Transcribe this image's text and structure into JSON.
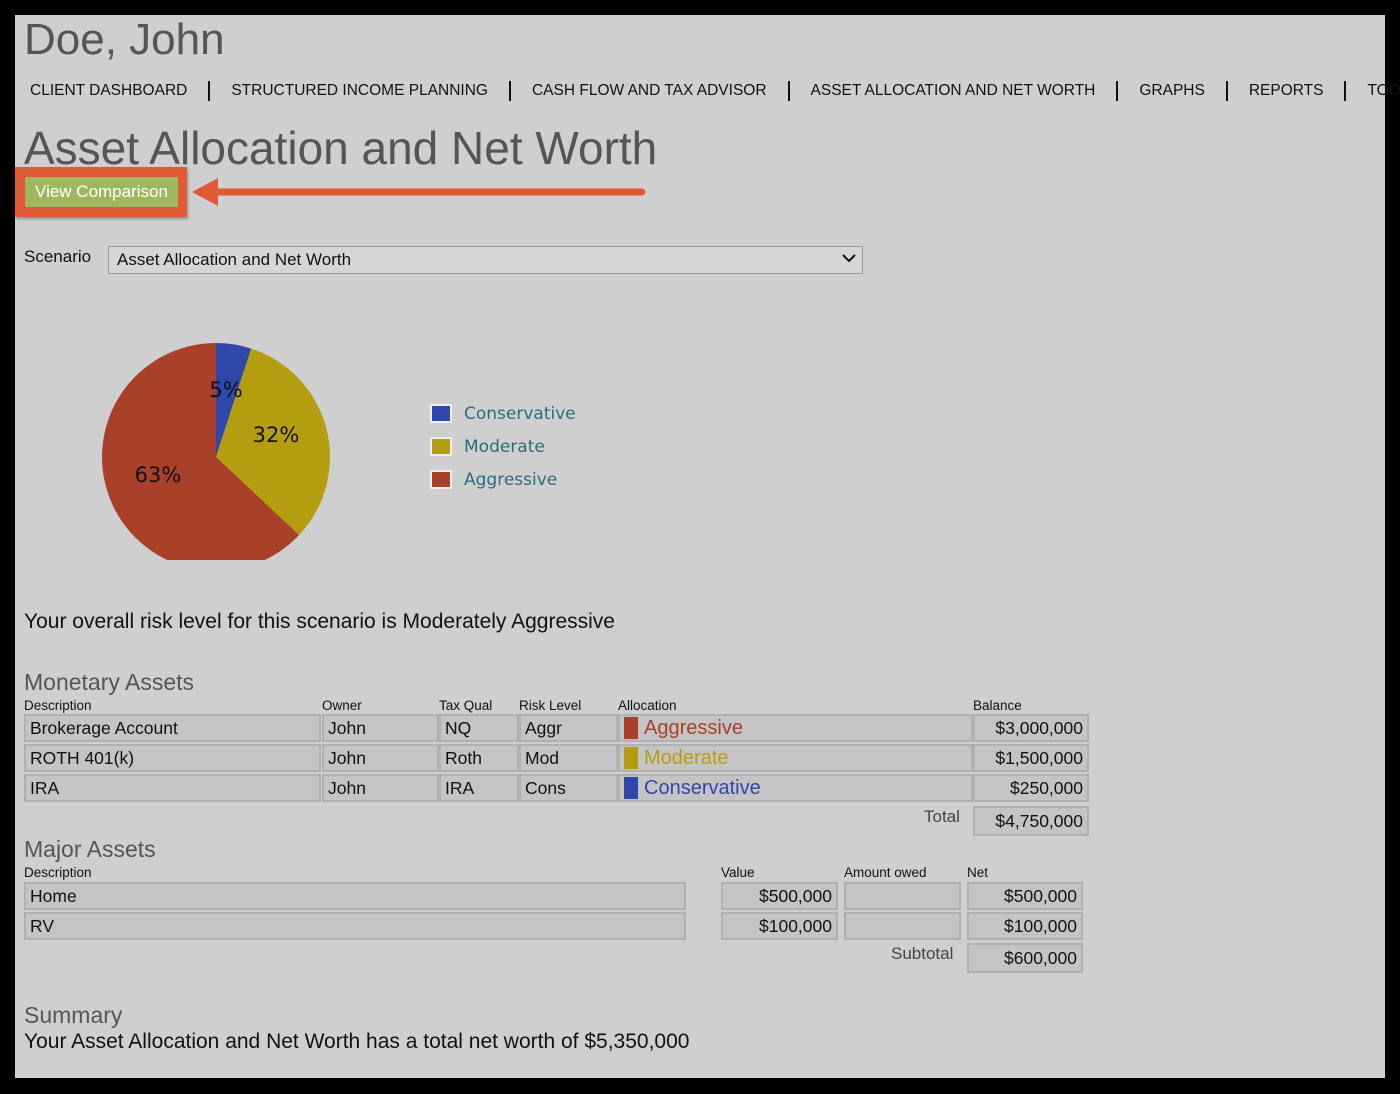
{
  "client_name": "Doe, John",
  "nav": [
    "CLIENT DASHBOARD",
    "STRUCTURED INCOME PLANNING",
    "CASH FLOW AND TAX ADVISOR",
    "ASSET ALLOCATION AND NET WORTH",
    "GRAPHS",
    "REPORTS",
    "TOOLS"
  ],
  "page_title": "Asset Allocation and Net Worth",
  "view_comparison_label": "View Comparison",
  "annotation": {
    "color": "#e05a35"
  },
  "scenario": {
    "label": "Scenario",
    "selected": "Asset Allocation and Net Worth"
  },
  "colors": {
    "Conservative": "#2f47a8",
    "Moderate": "#b59d10",
    "Aggressive": "#a8402a"
  },
  "chart_data": {
    "type": "pie",
    "slices": [
      {
        "name": "Conservative",
        "value": 5,
        "label": "5%"
      },
      {
        "name": "Moderate",
        "value": 32,
        "label": "32%"
      },
      {
        "name": "Aggressive",
        "value": 63,
        "label": "63%"
      }
    ],
    "legend": [
      "Conservative",
      "Moderate",
      "Aggressive"
    ],
    "legend_position": "right"
  },
  "risk_text": "Your overall risk level for this scenario is Moderately Aggressive",
  "monetary": {
    "title": "Monetary Assets",
    "headers": {
      "description": "Description",
      "owner": "Owner",
      "tax": "Tax Qual",
      "risk": "Risk Level",
      "allocation": "Allocation",
      "balance": "Balance"
    },
    "rows": [
      {
        "description": "Brokerage Account",
        "owner": "John",
        "tax": "NQ",
        "risk": "Aggr",
        "allocation": "Aggressive",
        "balance": "$3,000,000"
      },
      {
        "description": " ROTH 401(k)",
        "owner": "John",
        "tax": "Roth",
        "risk": "Mod",
        "allocation": "Moderate",
        "balance": "$1,500,000"
      },
      {
        "description": "IRA",
        "owner": "John",
        "tax": "IRA",
        "risk": "Cons",
        "allocation": "Conservative",
        "balance": "$250,000"
      }
    ],
    "total_label": "Total",
    "total": "$4,750,000"
  },
  "major": {
    "title": "Major Assets",
    "headers": {
      "description": "Description",
      "value": "Value",
      "owed": "Amount owed",
      "net": "Net"
    },
    "rows": [
      {
        "description": "Home",
        "value": "$500,000",
        "owed": "",
        "net": "$500,000"
      },
      {
        "description": "RV",
        "value": "$100,000",
        "owed": "",
        "net": "$100,000"
      }
    ],
    "subtotal_label": "Subtotal",
    "subtotal": "$600,000"
  },
  "summary": {
    "title": "Summary",
    "text": "Your Asset Allocation and Net Worth has a total net worth of $5,350,000"
  }
}
